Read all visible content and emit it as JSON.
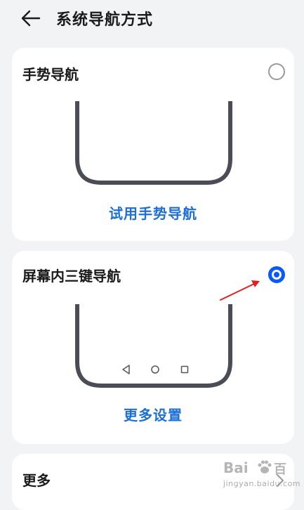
{
  "header": {
    "title": "系统导航方式",
    "back_icon": "arrow-left-icon"
  },
  "options": {
    "gesture": {
      "title": "手势导航",
      "selected": false,
      "action_label": "试用手势导航"
    },
    "three_key": {
      "title": "屏幕内三键导航",
      "selected": true,
      "action_label": "更多设置",
      "keys": [
        "back-triangle-icon",
        "home-circle-icon",
        "recent-square-icon"
      ]
    }
  },
  "more": {
    "title": "更多",
    "icon": "chevron-right-icon"
  },
  "colors": {
    "accent": "#0a59f7",
    "link": "#1d6fd6",
    "annotation_arrow": "#e02020",
    "background": "#f1f3f5"
  },
  "watermark": {
    "logo_left": "Bai",
    "logo_right": "百",
    "url": "jingyan.baidu.com"
  }
}
